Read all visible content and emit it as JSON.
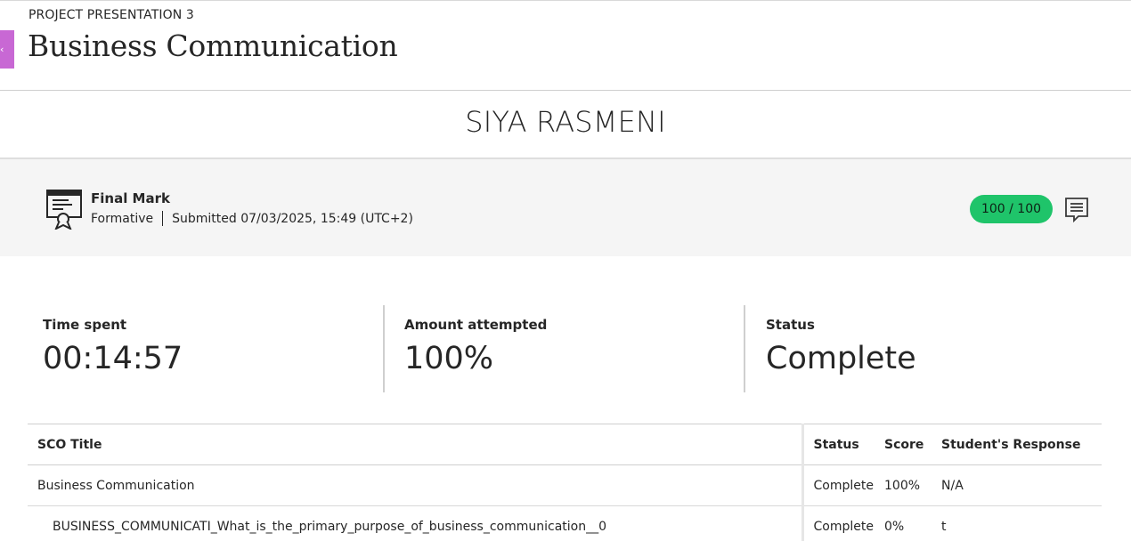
{
  "header": {
    "eyebrow": "PROJECT PRESENTATION 3",
    "title": "Business Communication",
    "side_tab_glyph": "‹"
  },
  "student": {
    "name": "SIYA RASMENI"
  },
  "grade": {
    "label": "Final Mark",
    "type": "Formative",
    "submitted": "Submitted 07/03/2025, 15:49 (UTC+2)",
    "score": "100 / 100",
    "icon": "certificate-icon",
    "feedback_icon": "feedback-comment-icon",
    "pill_color": "#1fc46a"
  },
  "stats": [
    {
      "label": "Time spent",
      "value": "00:14:57"
    },
    {
      "label": "Amount attempted",
      "value": "100%"
    },
    {
      "label": "Status",
      "value": "Complete"
    }
  ],
  "table": {
    "columns": [
      "SCO Title",
      "Status",
      "Score",
      "Student's Response"
    ],
    "rows": [
      {
        "title": "Business Communication",
        "status": "Complete",
        "score": "100%",
        "response": "N/A"
      },
      {
        "title": "BUSINESS_COMMUNICATI_What_is_the_primary_purpose_of_business_communication__0",
        "status": "Complete",
        "score": "0%",
        "response": "t"
      }
    ]
  }
}
